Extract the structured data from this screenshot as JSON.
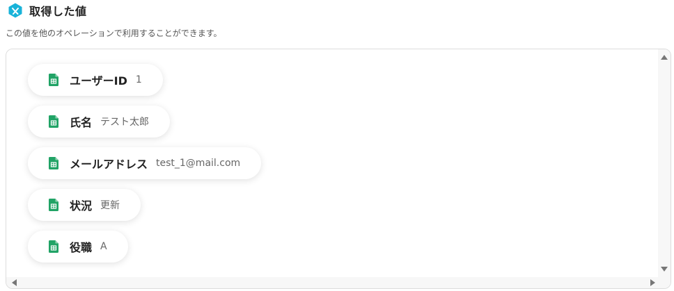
{
  "header": {
    "title": "取得した値",
    "icon": "app-logo-icon",
    "icon_color": "#19b3d9"
  },
  "description": "この値を他のオペレーションで利用することができます。",
  "fields": [
    {
      "label": "ユーザーID",
      "value": "1",
      "icon": "sheet-icon"
    },
    {
      "label": "氏名",
      "value": "テスト太郎",
      "icon": "sheet-icon"
    },
    {
      "label": "メールアドレス",
      "value": "test_1@mail.com",
      "icon": "sheet-icon"
    },
    {
      "label": "状況",
      "value": "更新",
      "icon": "sheet-icon"
    },
    {
      "label": "役職",
      "value": "A",
      "icon": "sheet-icon"
    }
  ],
  "colors": {
    "sheet_green": "#21a366",
    "accent": "#19b3d9"
  }
}
